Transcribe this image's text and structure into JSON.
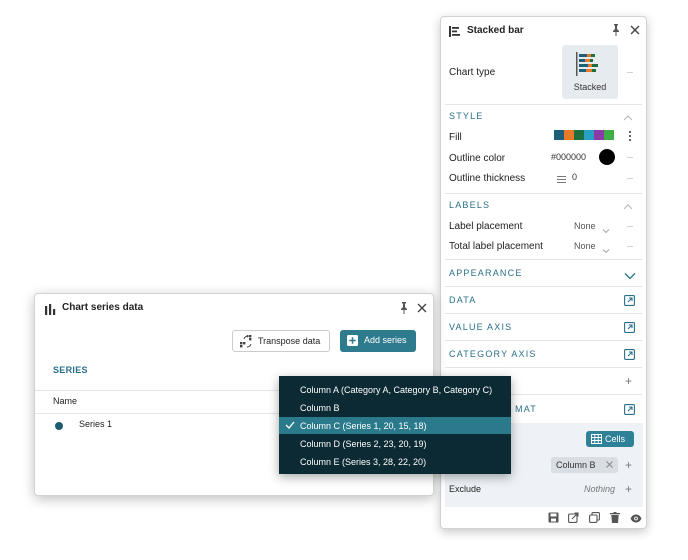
{
  "colors": {
    "accent": "#2e7b8e",
    "section_heading": "#2a6f8a",
    "dropdown_bg": "#0c2a33",
    "dropdown_selected": "#2a7a8c",
    "fill_swatches": [
      "#1d5f78",
      "#e8792b",
      "#1f6e3e",
      "#27a0c4",
      "#8b3aa8",
      "#3fae47"
    ]
  },
  "panel": {
    "title": "Stacked bar",
    "chart_type_label": "Chart type",
    "chart_type_value": "Stacked",
    "style_heading": "STYLE",
    "fill_label": "Fill",
    "outline_color_label": "Outline color",
    "outline_color_value": "#000000",
    "outline_thickness_label": "Outline thickness",
    "outline_thickness_value": "0",
    "labels_heading": "LABELS",
    "label_placement_label": "Label placement",
    "label_placement_value": "None",
    "total_label_placement_label": "Total label placement",
    "total_label_placement_value": "None",
    "appearance_heading": "APPEARANCE",
    "data_heading": "DATA",
    "value_axis_heading": "VALUE AXIS",
    "category_axis_heading": "CATEGORY AXIS",
    "format_heading_partial": "MAT",
    "cells_button": "Cells",
    "column_chip": "Column B",
    "exclude_label": "Exclude",
    "exclude_value": "Nothing"
  },
  "dialog": {
    "title": "Chart series data",
    "transpose_button": "Transpose data",
    "add_series_button": "Add series",
    "series_heading": "SERIES",
    "name_column": "Name",
    "series": [
      {
        "name": "Series 1"
      }
    ]
  },
  "dropdown": {
    "items": [
      {
        "label": "Column A (Category A, Category B, Category C)",
        "selected": false
      },
      {
        "label": "Column B",
        "selected": false
      },
      {
        "label": "Column C (Series 1, 20, 15, 18)",
        "selected": true
      },
      {
        "label": "Column D (Series 2, 23, 20, 19)",
        "selected": false
      },
      {
        "label": "Column E (Series 3, 28, 22, 20)",
        "selected": false
      }
    ]
  }
}
